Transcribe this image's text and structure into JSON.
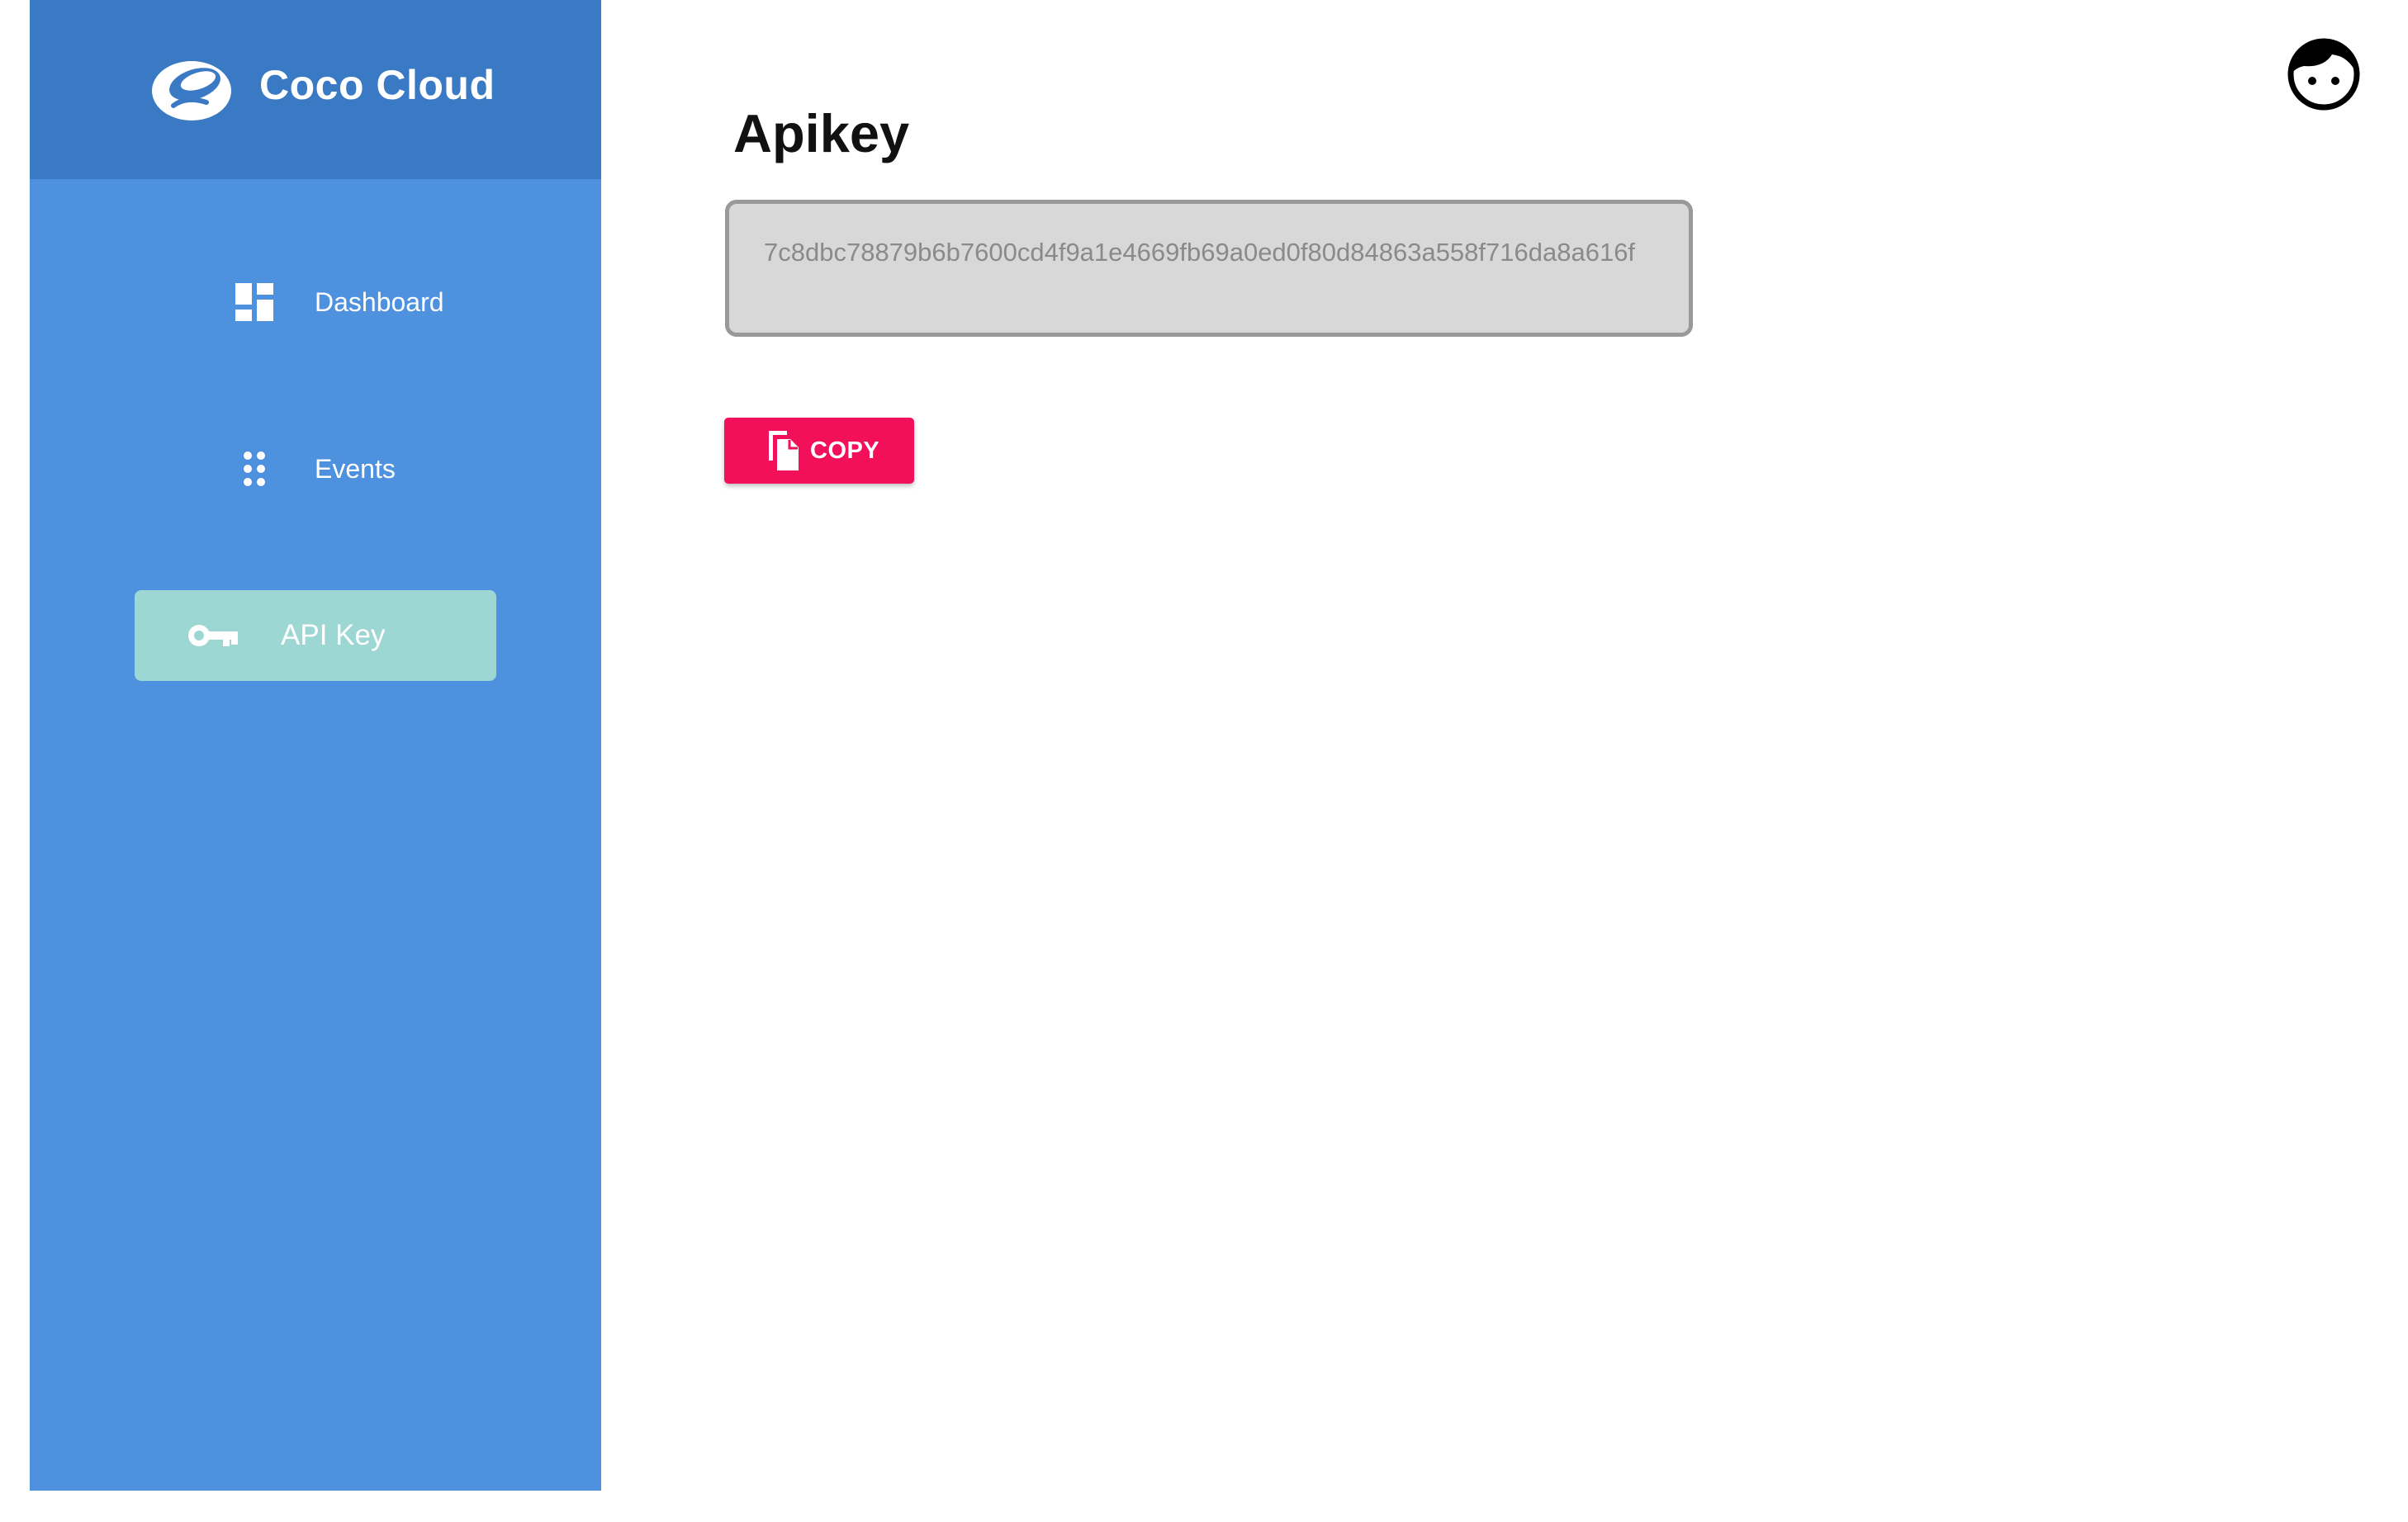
{
  "brand": {
    "title": "Coco Cloud",
    "logo_icon": "coco-cloud-logo-icon"
  },
  "sidebar": {
    "items": [
      {
        "label": "Dashboard",
        "icon": "dashboard-icon",
        "active": false
      },
      {
        "label": "Events",
        "icon": "dots-grid-icon",
        "active": false
      },
      {
        "label": "API Key",
        "icon": "key-icon",
        "active": true
      }
    ]
  },
  "main": {
    "title": "Apikey",
    "api_key": "7c8dbc78879b6b7600cd4f9a1e4669fb69a0ed0f80d84863a558f716da8a616f",
    "copy_label": "COPY",
    "copy_icon": "copy-icon"
  },
  "header": {
    "avatar_icon": "user-face-icon"
  },
  "colors": {
    "sidebar": "#4d91df",
    "brand_header": "#3a79c4",
    "active_item": "#9dd7d4",
    "copy_button": "#f2105a",
    "key_box_bg": "#d8d8d8",
    "key_box_border": "#999999"
  }
}
